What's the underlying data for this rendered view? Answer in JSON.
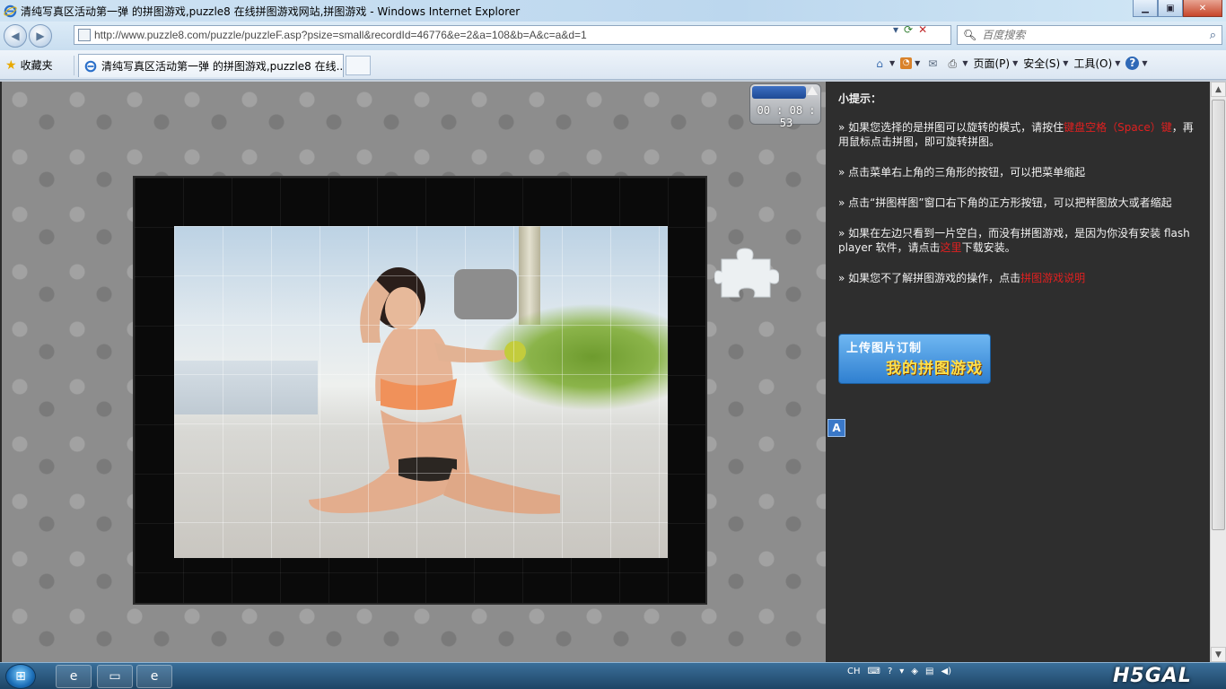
{
  "window": {
    "title": "清纯写真区活动第一弹 的拼图游戏,puzzle8 在线拼图游戏网站,拼图游戏 - Windows Internet Explorer",
    "controls": [
      "minimize",
      "maximize",
      "close"
    ]
  },
  "address_bar": {
    "url": "http://www.puzzle8.com/puzzle/puzzleF.asp?psize=small&recordId=46776&e=2&a=108&b=A&c=a&d=1",
    "search_placeholder": "百度搜索"
  },
  "tabs": {
    "favorites_label": "收藏夹",
    "active_tab_title": "清纯写真区活动第一弹 的拼图游戏,puzzle8 在线..."
  },
  "command_bar": {
    "page_label": "页面(P)",
    "safety_label": "安全(S)",
    "tools_label": "工具(O)"
  },
  "game": {
    "timer": "00 : 08 : 53"
  },
  "tips": {
    "heading": "小提示：",
    "items": [
      {
        "prefix": "» 如果您选择的是拼图可以旋转的模式，请按住",
        "highlight": "键盘空格（Space）键",
        "suffix": "，再用鼠标点击拼图，即可旋转拼图。"
      },
      {
        "prefix": "» 点击菜单右上角的三角形的按钮，可以把菜单缩起",
        "highlight": "",
        "suffix": ""
      },
      {
        "prefix": "» 点击“拼图样图”窗口右下角的正方形按钮，可以把样图放大或者缩起",
        "highlight": "",
        "suffix": ""
      },
      {
        "prefix": "» 如果在左边只看到一片空白，而没有拼图游戏，是因为你没有安装 flash player 软件，请点击",
        "highlight": "这里",
        "suffix": "下载安装。"
      },
      {
        "prefix": "» 如果您不了解拼图游戏的操作，点击",
        "highlight": "拼图游戏说明",
        "suffix": ""
      }
    ],
    "banner_line1": "上传图片订制",
    "banner_line2": "我的拼图游戏",
    "small_icon": "A"
  },
  "taskbar": {
    "tray_lang": "CH",
    "logo_text": "H5GAL"
  },
  "colors": {
    "highlight_red": "#e02020",
    "panel_bg": "#2e2e2e",
    "board_bg": "#0a0a0a"
  }
}
